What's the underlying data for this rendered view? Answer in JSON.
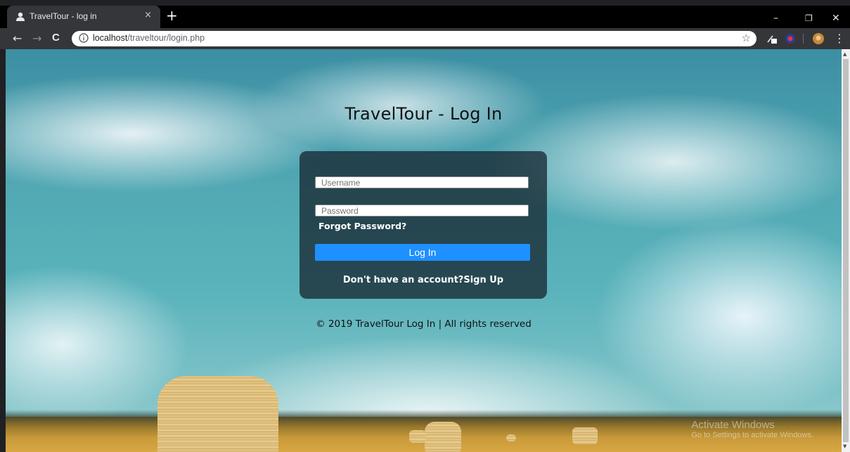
{
  "browser": {
    "tab_title": "TravelTour - log in",
    "tab_close": "×",
    "new_tab": "+",
    "url_host": "localhost",
    "url_path": "/traveltour/login.php",
    "controls": {
      "minimize": "–",
      "restore": "❐",
      "close": "✕"
    },
    "nav": {
      "back": "←",
      "forward": "→",
      "reload": "C"
    },
    "star": "☆",
    "menu": "⋮"
  },
  "page": {
    "title": "TravelTour - Log In",
    "username_placeholder": "Username",
    "password_placeholder": "Password",
    "forgot_password": "Forgot Password?",
    "login_button": "Log In",
    "signup_prompt": "Don't have an account?",
    "signup_link": "Sign Up",
    "footer": "© 2019 TravelTour Log In | All rights reserved"
  },
  "os": {
    "watermark_title": "Activate Windows",
    "watermark_sub": "Go to Settings to activate Windows."
  },
  "colors": {
    "accent_button": "#1e90ff",
    "login_box_bg": "rgba(20,30,40,0.72)"
  }
}
